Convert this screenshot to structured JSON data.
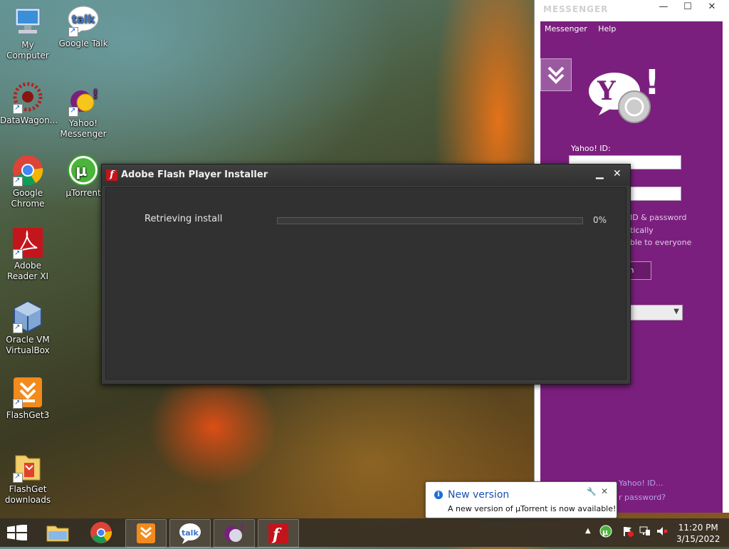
{
  "desktop": {
    "icons": [
      {
        "label": "My Computer"
      },
      {
        "label": "Google Talk"
      },
      {
        "label": "DataWagon..."
      },
      {
        "label": "Yahoo! Messenger"
      },
      {
        "label": "Google Chrome"
      },
      {
        "label": "µTorrent"
      },
      {
        "label": "Adobe Reader XI"
      },
      {
        "label": "Oracle VM VirtualBox"
      },
      {
        "label": "FlashGet3"
      },
      {
        "label": "FlashGet downloads"
      }
    ]
  },
  "flash_installer": {
    "title": "Adobe Flash Player Installer",
    "status": "Retrieving install",
    "progress_percent": 0,
    "progress_label": "0%"
  },
  "yahoo": {
    "title": "MESSENGER",
    "menu": [
      "Messenger",
      "Help"
    ],
    "id_label": "Yahoo! ID:",
    "remember": "ID & password",
    "auto": "tically",
    "invisible": "ble to everyone",
    "signin": "n",
    "forgot_id": "Yahoo! ID...",
    "forgot_pw": "r password?"
  },
  "notification": {
    "heading": "New version",
    "message": "A new version of µTorrent is now available!"
  },
  "taskbar": {
    "time": "11:20 PM",
    "date": "3/15/2022"
  },
  "colors": {
    "yahoo_purple": "#7b1f7e",
    "flash_red": "#c2151b",
    "link_blue": "#1c4fb0"
  }
}
